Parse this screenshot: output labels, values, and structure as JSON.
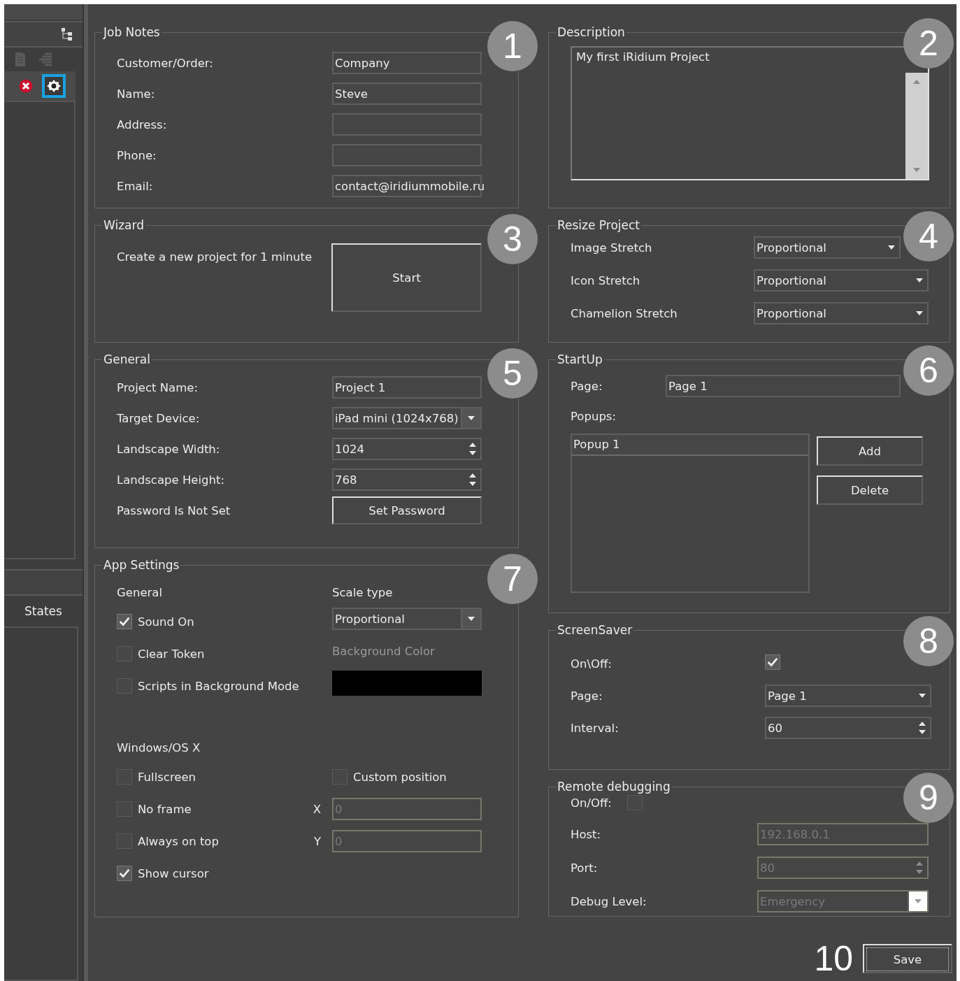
{
  "sidebar": {
    "toolbar": [
      {
        "kind": "document",
        "disabled": true
      },
      {
        "kind": "layers",
        "disabled": true
      }
    ],
    "tools": [
      {
        "kind": "delete",
        "selected": false
      },
      {
        "kind": "settings",
        "selected": true
      }
    ],
    "states_tab": "States"
  },
  "job_notes": {
    "title": "Job Notes",
    "callout": "1",
    "fields": [
      {
        "label": "Customer/Order:",
        "value": "Company"
      },
      {
        "label": "Name:",
        "value": "Steve"
      },
      {
        "label": "Address:"
      },
      {
        "label": "Phone:"
      },
      {
        "label": "Email:",
        "value": "contact@iridiummobile.ru"
      }
    ]
  },
  "wizard": {
    "title": "Wizard",
    "callout": "3",
    "text": "Create a new project for 1 minute",
    "button": "Start"
  },
  "general": {
    "title": "General",
    "callout": "5",
    "rows": [
      {
        "kind": "text",
        "label": "Project Name:",
        "value": "Project 1"
      },
      {
        "kind": "combo",
        "label": "Target Device:",
        "value": "iPad mini (1024x768)"
      },
      {
        "kind": "spin",
        "label": "Landscape Width:",
        "value": "1024"
      },
      {
        "kind": "spin",
        "label": "Landscape Height:",
        "value": "768"
      },
      {
        "kind": "button",
        "label": "Password Is Not Set",
        "value": "Set Password"
      }
    ]
  },
  "app_settings": {
    "title": "App Settings",
    "callout": "7",
    "general_heading": "General",
    "scale_type_label": "Scale type",
    "scale_type": "Proportional",
    "background_color_label": "Background Color",
    "general_options": [
      {
        "label": "Sound On",
        "checked": true
      },
      {
        "label": "Clear Token",
        "checked": false
      },
      {
        "label": "Scripts in Background Mode",
        "checked": false
      }
    ],
    "windows_heading": "Windows/OS X",
    "windows_options": [
      {
        "label": "Fullscreen",
        "checked": false
      },
      {
        "label": "No frame",
        "checked": false
      },
      {
        "label": "Always on top",
        "checked": false
      },
      {
        "label": "Show cursor",
        "checked": true
      }
    ],
    "custom_position": {
      "label": "Custom position",
      "checked": false
    },
    "x": {
      "label": "X",
      "value": "0",
      "disabled": true
    },
    "y": {
      "label": "Y",
      "value": "0",
      "disabled": true
    }
  },
  "description": {
    "title": "Description",
    "callout": "2",
    "value": "My first iRidium Project"
  },
  "resize_project": {
    "title": "Resize Project",
    "callout": "4",
    "rows": [
      {
        "label": "Image Stretch",
        "value": "Proportional"
      },
      {
        "label": "Icon Stretch",
        "value": "Proportional"
      },
      {
        "label": "Chamelion Stretch",
        "value": "Proportional"
      }
    ]
  },
  "startup": {
    "title": "StartUp",
    "callout": "6",
    "page_label": "Page:",
    "page": "Page 1",
    "popups_label": "Popups:",
    "popups": [
      {
        "label": "Popup 1",
        "selected": true
      }
    ],
    "buttons": [
      "Add",
      "Delete"
    ]
  },
  "screensaver": {
    "title": "ScreenSaver",
    "callout": "8",
    "on_label": "On\\Off:",
    "on": true,
    "page_label": "Page:",
    "page": "Page 1",
    "interval_label": "Interval:",
    "interval": "60"
  },
  "remote_debugging": {
    "title": "Remote debugging",
    "callout": "9",
    "on_label": "On/Off:",
    "on": false,
    "host": {
      "label": "Host:",
      "value": "192.168.0.1",
      "disabled": true
    },
    "port": {
      "label": "Port:",
      "value": "80",
      "disabled": true
    },
    "level": {
      "label": "Debug Level:",
      "value": "Emergency",
      "disabled": true
    }
  },
  "footer": {
    "callout": "10",
    "save": "Save"
  }
}
